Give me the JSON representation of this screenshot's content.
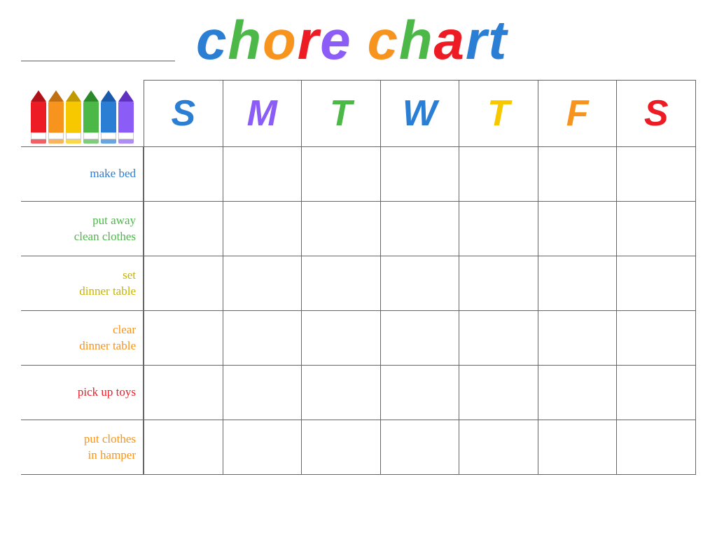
{
  "header": {
    "title_letters": [
      {
        "char": "c",
        "class": "t-c"
      },
      {
        "char": "h",
        "class": "t-h"
      },
      {
        "char": "o",
        "class": "t-o"
      },
      {
        "char": "r",
        "class": "t-r"
      },
      {
        "char": "e",
        "class": "t-e"
      }
    ],
    "title2_letters": [
      {
        "char": "c",
        "class": "t-ch"
      },
      {
        "char": "h",
        "class": "t-ca"
      },
      {
        "char": "a",
        "class": "t-cr"
      },
      {
        "char": "r",
        "class": "t-ct"
      },
      {
        "char": "t",
        "class": "t-c"
      }
    ]
  },
  "crayons": [
    {
      "color": "#ed1c24",
      "tip": "#b01018"
    },
    {
      "color": "#f7941d",
      "tip": "#c07010"
    },
    {
      "color": "#f7c700",
      "tip": "#c09a00"
    },
    {
      "color": "#4cb847",
      "tip": "#2a8a2a"
    },
    {
      "color": "#2a7fd4",
      "tip": "#1a5aaa"
    },
    {
      "color": "#8b5cf6",
      "tip": "#6030c0"
    }
  ],
  "days": [
    {
      "label": "S",
      "class": "day-S1"
    },
    {
      "label": "M",
      "class": "day-M"
    },
    {
      "label": "T",
      "class": "day-T1"
    },
    {
      "label": "W",
      "class": "day-W"
    },
    {
      "label": "T",
      "class": "day-T2"
    },
    {
      "label": "F",
      "class": "day-F"
    },
    {
      "label": "S",
      "class": "day-S2"
    }
  ],
  "chores": [
    {
      "label": "make bed",
      "multiline": false,
      "rowClass": "chore-1"
    },
    {
      "label": "put away\nclean clothes",
      "multiline": true,
      "rowClass": "chore-2"
    },
    {
      "label": "set\ndinner table",
      "multiline": true,
      "rowClass": "chore-3"
    },
    {
      "label": "clear\ndinner table",
      "multiline": true,
      "rowClass": "chore-4"
    },
    {
      "label": "pick up toys",
      "multiline": false,
      "rowClass": "chore-5"
    },
    {
      "label": "put clothes\nin hamper",
      "multiline": true,
      "rowClass": "chore-6"
    }
  ]
}
